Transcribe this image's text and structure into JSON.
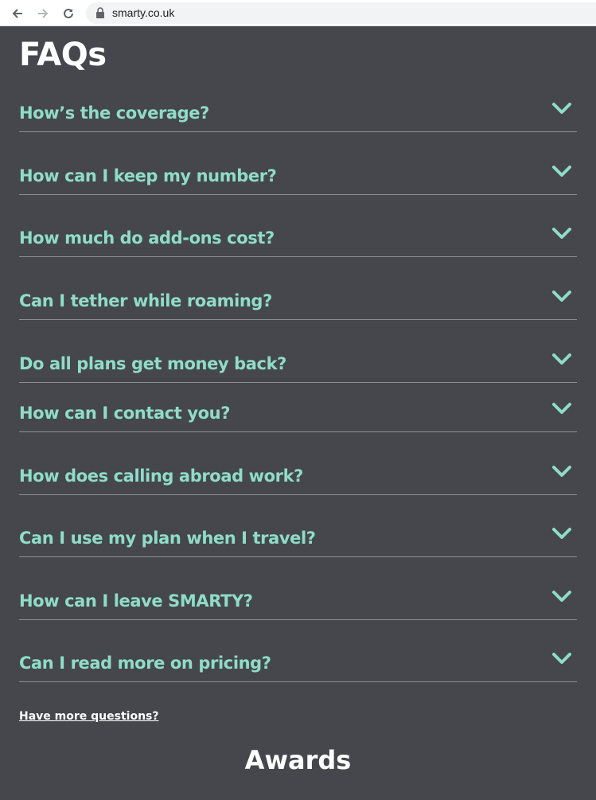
{
  "browser": {
    "url": "smarty.co.uk"
  },
  "faq": {
    "title": "FAQs",
    "accent_color": "#8fdcc9",
    "items": [
      {
        "question": "How’s the coverage?"
      },
      {
        "question": "How can I keep my number?"
      },
      {
        "question": "How much do add-ons cost?"
      },
      {
        "question": "Can I tether while roaming?"
      },
      {
        "question": "Do all plans get money back?"
      },
      {
        "question": "How can I contact you?"
      },
      {
        "question": "How does calling abroad work?"
      },
      {
        "question": "Can I use my plan when I travel?"
      },
      {
        "question": "How can I leave SMARTY?"
      },
      {
        "question": "Can I read more on pricing?"
      }
    ],
    "more_link": "Have more questions?"
  },
  "awards": {
    "title": "Awards"
  }
}
